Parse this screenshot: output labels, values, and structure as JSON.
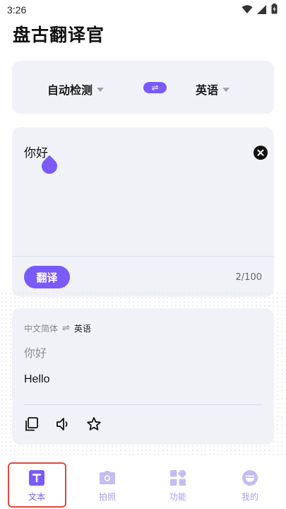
{
  "status_bar": {
    "time": "3:26"
  },
  "app": {
    "title": "盘古翻译官"
  },
  "lang_bar": {
    "source": "自动检测",
    "target": "英语",
    "swap_symbol": "⇌"
  },
  "input": {
    "text": "你好",
    "translate_label": "翻译",
    "char_count": "2/100"
  },
  "result": {
    "source_lang": "中文简体",
    "arrow": "⇌",
    "target_lang": "英语",
    "source_text": "你好",
    "translated_text": "Hello"
  },
  "nav": {
    "items": [
      {
        "label": "文本",
        "icon": "text-icon",
        "active": true
      },
      {
        "label": "拍照",
        "icon": "camera-icon",
        "active": false
      },
      {
        "label": "功能",
        "icon": "apps-icon",
        "active": false
      },
      {
        "label": "我的",
        "icon": "profile-icon",
        "active": false
      }
    ]
  },
  "colors": {
    "accent": "#7a5af8",
    "card_bg": "#f1f2f8",
    "nav_inactive": "#a89ee8",
    "highlight": "#e0473c"
  }
}
